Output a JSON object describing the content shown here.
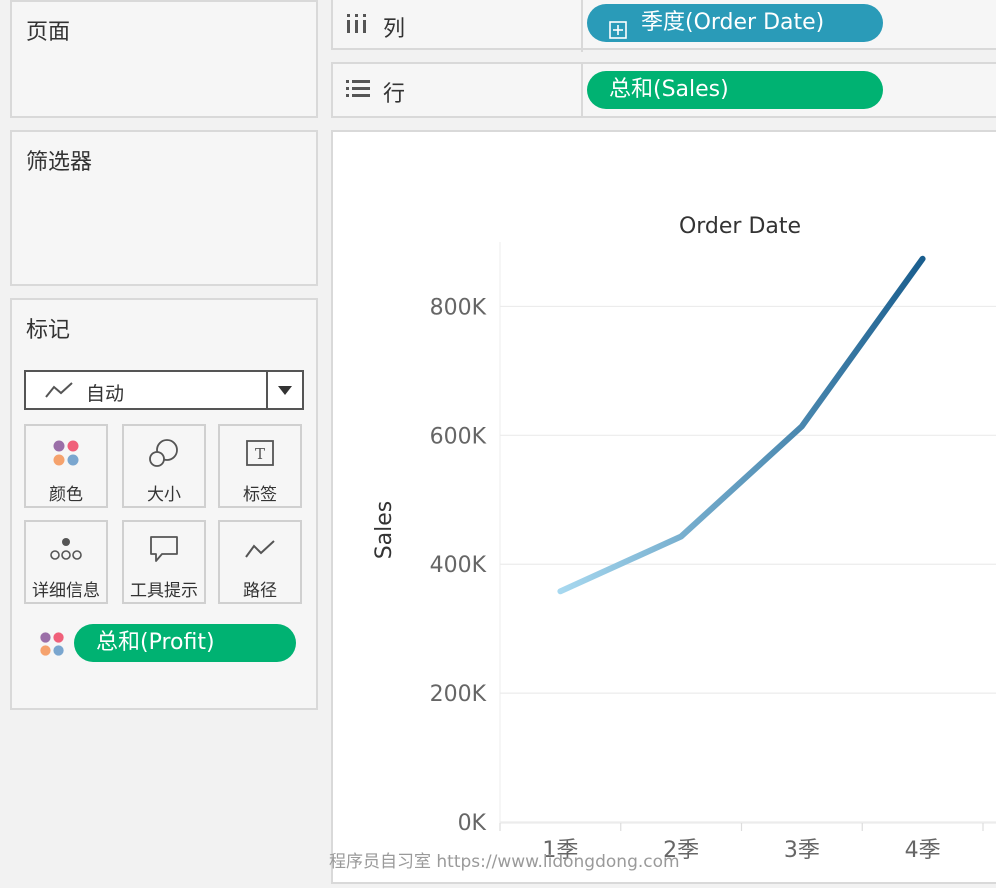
{
  "cards": {
    "pages_title": "页面",
    "filters_title": "筛选器",
    "marks_title": "标记"
  },
  "marks": {
    "type_label": "自动",
    "type_icon": "line-chart-icon",
    "buttons": [
      {
        "label": "颜色",
        "icon": "color-dots-icon"
      },
      {
        "label": "大小",
        "icon": "size-circles-icon"
      },
      {
        "label": "标签",
        "icon": "text-label-icon"
      },
      {
        "label": "详细信息",
        "icon": "detail-dots-icon"
      },
      {
        "label": "工具提示",
        "icon": "tooltip-bubble-icon"
      },
      {
        "label": "路径",
        "icon": "path-line-icon"
      }
    ],
    "color_field_pill": "总和(Profit)",
    "color_field_icon": "color-dots-icon"
  },
  "shelves": {
    "columns_label": "列",
    "columns_icon": "columns-icon",
    "columns_pill": "季度(Order Date)",
    "columns_pill_icon": "expand-plus-icon",
    "rows_label": "行",
    "rows_icon": "rows-icon",
    "rows_pill": "总和(Sales)"
  },
  "colors": {
    "dimension_pill": "#2a9bb8",
    "measure_pill": "#00b272",
    "line_start": "#a8d9f0",
    "line_end": "#1a5e8e"
  },
  "chart_data": {
    "type": "line",
    "title": "Order Date",
    "xlabel": "",
    "ylabel": "Sales",
    "categories": [
      "1季",
      "2季",
      "3季",
      "4季"
    ],
    "values": [
      358000,
      443000,
      614000,
      874000
    ],
    "ylim": [
      0,
      900000
    ],
    "yticks": [
      0,
      200000,
      400000,
      600000,
      800000
    ],
    "ytick_labels": [
      "0K",
      "200K",
      "400K",
      "600K",
      "800K"
    ],
    "grid": true,
    "color_by": "总和(Profit)"
  },
  "watermark": "程序员自习室 https://www.lidongdong.com"
}
